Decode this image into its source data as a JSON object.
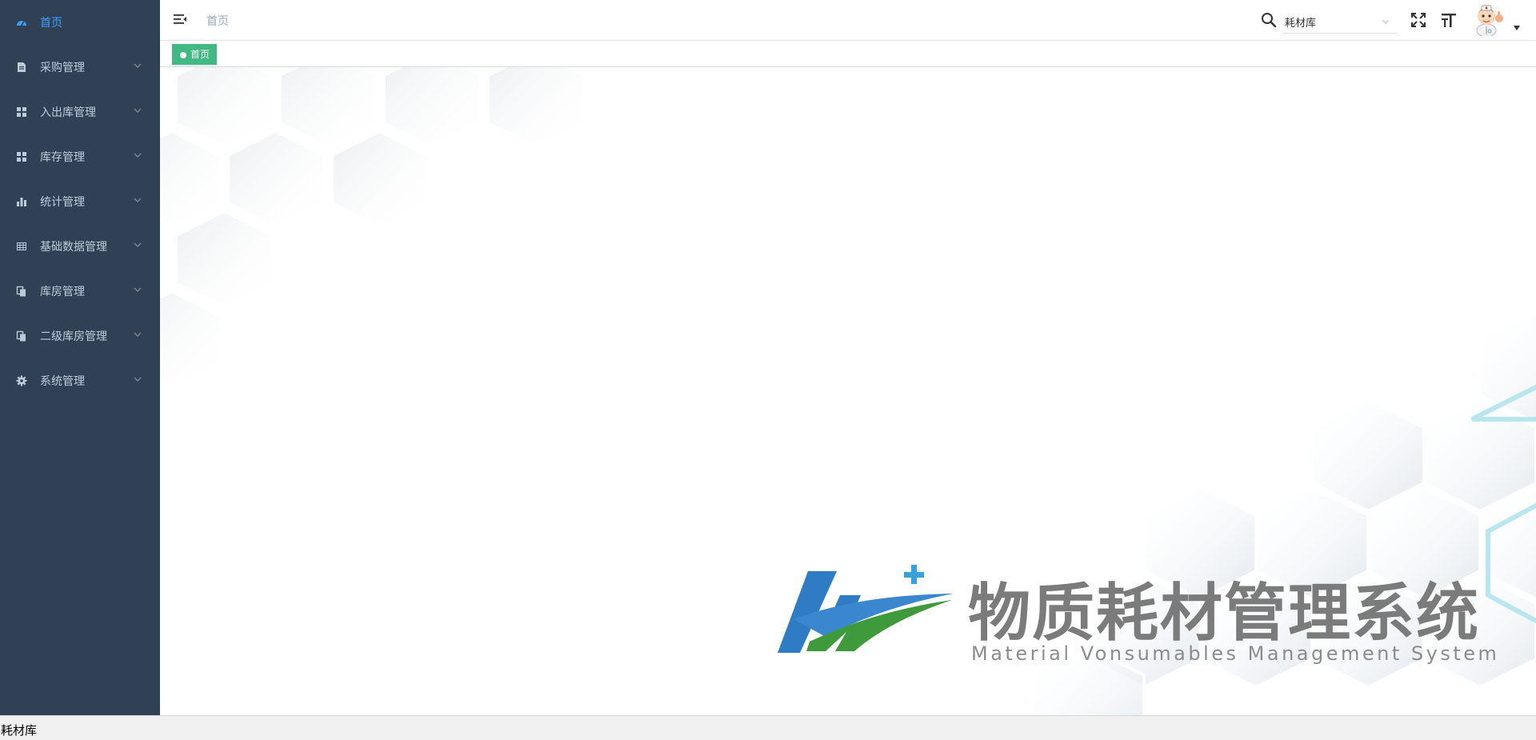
{
  "sidebar": {
    "items": [
      {
        "label": "首页",
        "icon": "dashboard-icon",
        "active": true
      },
      {
        "label": "采购管理",
        "icon": "document-icon"
      },
      {
        "label": "入出库管理",
        "icon": "grid-icon"
      },
      {
        "label": "库存管理",
        "icon": "grid-icon"
      },
      {
        "label": "统计管理",
        "icon": "bar-chart-icon"
      },
      {
        "label": "基础数据管理",
        "icon": "table-icon"
      },
      {
        "label": "库房管理",
        "icon": "copy-icon"
      },
      {
        "label": "二级库房管理",
        "icon": "copy-icon"
      },
      {
        "label": "系统管理",
        "icon": "gear-icon"
      }
    ],
    "background": "#304156",
    "active_color": "#409eff"
  },
  "header": {
    "breadcrumb": "首页",
    "warehouse_select": {
      "value": "耗材库"
    }
  },
  "tags": [
    {
      "label": "首页",
      "color": "#42b983",
      "active": true
    }
  ],
  "brand": {
    "title": "物质耗材管理系统",
    "subtitle": "Material Vonsumables Management System",
    "logo_colors": {
      "blue": "#2f7bc4",
      "green": "#3e9a3a",
      "cross": "#3aa0dc"
    }
  },
  "statusbar": {
    "text": "耗材库"
  }
}
